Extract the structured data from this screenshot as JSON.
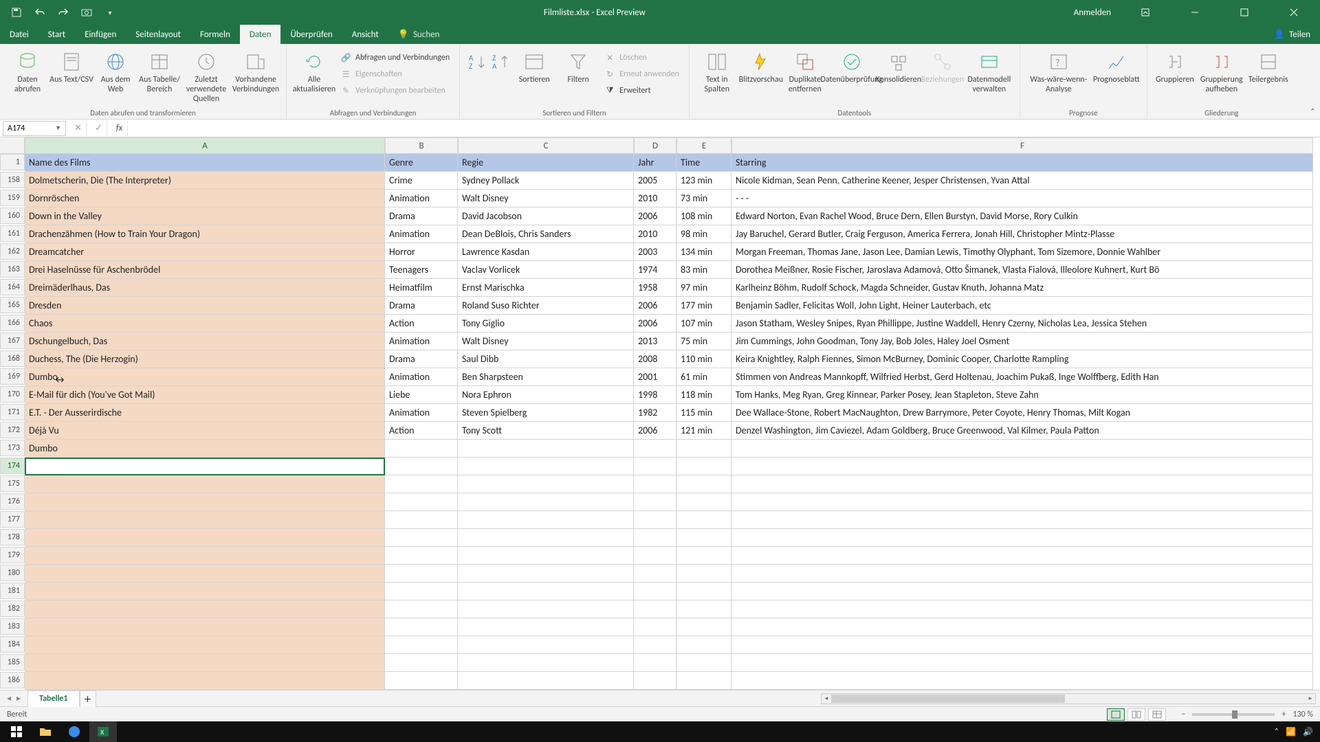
{
  "titlebar": {
    "title": "Filmliste.xlsx - Excel Preview",
    "signin": "Anmelden"
  },
  "tabs": {
    "datei": "Datei",
    "start": "Start",
    "einfuegen": "Einfügen",
    "layout": "Seitenlayout",
    "formeln": "Formeln",
    "daten": "Daten",
    "ueberpruefen": "Überprüfen",
    "ansicht": "Ansicht",
    "suchen": "Suchen",
    "teilen": "Teilen"
  },
  "ribbon": {
    "g1": {
      "label": "Daten abrufen und transformieren",
      "daten_abrufen": "Daten abrufen",
      "text_csv": "Aus Text/CSV",
      "web": "Aus dem Web",
      "tabelle": "Aus Tabelle/ Bereich",
      "zuletzt": "Zuletzt verwendete Quellen",
      "vorhanden": "Vorhandene Verbindungen"
    },
    "g2": {
      "label": "Abfragen und Verbindungen",
      "alle": "Alle aktualisieren",
      "abfragen": "Abfragen und Verbindungen",
      "eigenschaften": "Eigenschaften",
      "verknuepf": "Verknüpfungen bearbeiten"
    },
    "g3": {
      "label": "Sortieren und Filtern",
      "sortieren": "Sortieren",
      "filtern": "Filtern",
      "loeschen": "Löschen",
      "erneut": "Erneut anwenden",
      "erweitert": "Erweitert"
    },
    "g4": {
      "label": "Datentools",
      "text_spalten": "Text in Spalten",
      "blitz": "Blitzvorschau",
      "duplikate": "Duplikate entfernen",
      "validierung": "Datenüberprüfung",
      "konsolidieren": "Konsolidieren",
      "beziehungen": "Beziehungen",
      "datenmodell": "Datenmodell verwalten"
    },
    "g5": {
      "label": "Prognose",
      "was_waere": "Was-wäre-wenn-Analyse",
      "prognoseblatt": "Prognoseblatt"
    },
    "g6": {
      "label": "Gliederung",
      "gruppieren": "Gruppieren",
      "aufheben": "Gruppierung aufheben",
      "teilergebnis": "Teilergebnis"
    }
  },
  "namebox": "A174",
  "columns": [
    "A",
    "B",
    "C",
    "D",
    "E",
    "F"
  ],
  "headers": {
    "A": "Name des Films",
    "B": "Genre",
    "C": "Regie",
    "D": "Jahr",
    "E": "Time",
    "F": "Starring"
  },
  "first_row_num": 158,
  "rows": [
    {
      "n": 158,
      "A": "Dolmetscherin, Die (The Interpreter)",
      "B": "Crime",
      "C": "Sydney Pollack",
      "D": "2005",
      "E": "123 min",
      "F": "Nicole Kidman, Sean Penn, Catherine Keener, Jesper Christensen, Yvan Attal"
    },
    {
      "n": 159,
      "A": "Dornröschen",
      "B": "Animation",
      "C": "Walt Disney",
      "D": "2010",
      "E": "73 min",
      "F": "- - -"
    },
    {
      "n": 160,
      "A": "Down in the Valley",
      "B": "Drama",
      "C": "David Jacobson",
      "D": "2006",
      "E": "108 min",
      "F": "Edward Norton, Evan Rachel Wood, Bruce Dern, Ellen Burstyn, David Morse, Rory Culkin"
    },
    {
      "n": 161,
      "A": "Drachenzähmen (How to Train Your Dragon)",
      "B": "Animation",
      "C": "Dean DeBlois, Chris Sanders",
      "D": "2010",
      "E": "98 min",
      "F": "Jay Baruchel, Gerard Butler, Craig Ferguson, America Ferrera, Jonah Hill, Christopher Mintz-Plasse"
    },
    {
      "n": 162,
      "A": "Dreamcatcher",
      "B": "Horror",
      "C": "Lawrence Kasdan",
      "D": "2003",
      "E": "134 min",
      "F": "Morgan Freeman, Thomas Jane, Jason Lee, Damian Lewis, Timothy Olyphant, Tom Sizemore, Donnie Wahlber"
    },
    {
      "n": 163,
      "A": "Drei Haselnüsse für Aschenbrödel",
      "B": "Teenagers",
      "C": "Vaclav Vorlicek",
      "D": "1974",
      "E": "83 min",
      "F": "Dorothea Meißner, Rosie Fischer, Jaroslava Adamová, Otto Šimanek, Vlasta Fialová, Illeolore Kuhnert, Kurt Bö"
    },
    {
      "n": 164,
      "A": "Dreimäderlhaus, Das",
      "B": "Heimatfilm",
      "C": "Ernst Marischka",
      "D": "1958",
      "E": "97 min",
      "F": "Karlheinz Böhm, Rudolf Schock, Magda Schneider, Gustav Knuth, Johanna Matz"
    },
    {
      "n": 165,
      "A": "Dresden",
      "B": "Drama",
      "C": "Roland Suso Richter",
      "D": "2006",
      "E": "177 min",
      "F": "Benjamin Sadler, Felicitas Woll, John Light, Heiner Lauterbach, etc"
    },
    {
      "n": 166,
      "A": "Chaos",
      "B": "Action",
      "C": "Tony Giglio",
      "D": "2006",
      "E": "107 min",
      "F": "Jason Statham, Wesley Snipes, Ryan Phillippe, Justine Waddell, Henry Czerny, Nicholas Lea, Jessica Stehen"
    },
    {
      "n": 167,
      "A": "Dschungelbuch, Das",
      "B": "Animation",
      "C": "Walt Disney",
      "D": "2013",
      "E": "75 min",
      "F": "Jim Cummings, John Goodman, Tony Jay, Bob Joles, Haley Joel Osment"
    },
    {
      "n": 168,
      "A": "Duchess, The (Die Herzogin)",
      "B": "Drama",
      "C": "Saul Dibb",
      "D": "2008",
      "E": "110 min",
      "F": "Keira Knightley, Ralph Fiennes, Simon McBurney, Dominic Cooper, Charlotte Rampling"
    },
    {
      "n": 169,
      "A": "Dumbo",
      "B": "Animation",
      "C": "Ben Sharpsteen",
      "D": "2001",
      "E": "61 min",
      "F": "Stimmen von Andreas Mannkopff, Wilfried Herbst, Gerd Holtenau, Joachim Pukaß, Inge Wolffberg, Edith Han"
    },
    {
      "n": 170,
      "A": "E-Mail für dich (You've Got Mail)",
      "B": "Liebe",
      "C": "Nora Ephron",
      "D": "1998",
      "E": "118 min",
      "F": "Tom Hanks, Meg Ryan, Greg Kinnear, Parker Posey, Jean Stapleton, Steve Zahn"
    },
    {
      "n": 171,
      "A": "E.T. - Der Ausserirdische",
      "B": "Animation",
      "C": "Steven Spielberg",
      "D": "1982",
      "E": "115 min",
      "F": "Dee Wallace-Stone, Robert MacNaughton, Drew Barrymore, Peter Coyote, Henry Thomas, Milt Kogan"
    },
    {
      "n": 172,
      "A": "Déjà Vu",
      "B": "Action",
      "C": "Tony Scott",
      "D": "2006",
      "E": "121 min",
      "F": "Denzel Washington, Jim Caviezel, Adam Goldberg, Bruce Greenwood, Val Kilmer, Paula Patton"
    },
    {
      "n": 173,
      "A": "Dumbo",
      "B": "",
      "C": "",
      "D": "",
      "E": "",
      "F": ""
    }
  ],
  "empty_rows": [
    174,
    175,
    176,
    177,
    178,
    179,
    180,
    181,
    182,
    183,
    184,
    185,
    186
  ],
  "selected_row": 174,
  "sheet": {
    "tab": "Tabelle1"
  },
  "status": {
    "ready": "Bereit",
    "zoom": "130 %"
  }
}
